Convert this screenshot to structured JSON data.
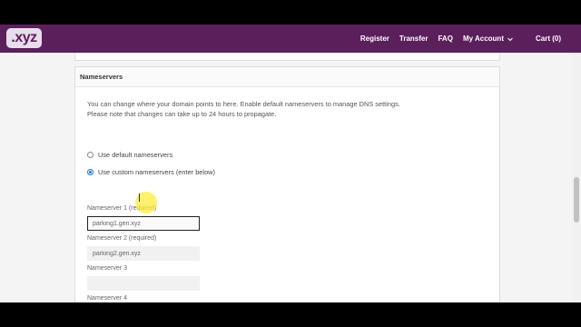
{
  "header": {
    "logo_text": ".xyz",
    "nav": {
      "register": "Register",
      "transfer": "Transfer",
      "faq": "FAQ",
      "account": "My Account",
      "cart": "Cart (0)"
    }
  },
  "panel": {
    "title": "Nameservers",
    "description_line1": "You can change where your domain points to here. Enable default nameservers to manage DNS settings.",
    "description_line2": "Please note that changes can take up to 24 hours to propagate.",
    "option_default": "Use default nameservers",
    "option_custom": "Use custom nameservers (enter below)",
    "selected_option": "custom"
  },
  "nameservers": [
    {
      "label": "Nameserver 1 (required)",
      "value": "parking1.gen.xyz"
    },
    {
      "label": "Nameserver 2 (required)",
      "value": "parking2.gen.xyz"
    },
    {
      "label": "Nameserver 3",
      "value": ""
    },
    {
      "label": "Nameserver 4",
      "value": ""
    }
  ],
  "colors": {
    "brand": "#5b1f5c",
    "radio_selected": "#1a73e8"
  }
}
